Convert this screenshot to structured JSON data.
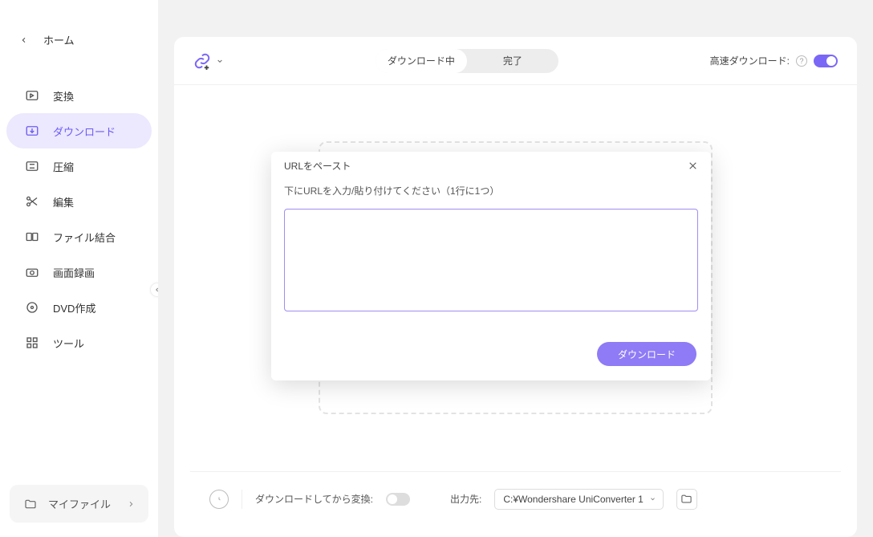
{
  "sidebar": {
    "home_label": "ホーム",
    "items": [
      {
        "label": "変換"
      },
      {
        "label": "ダウンロード"
      },
      {
        "label": "圧縮"
      },
      {
        "label": "編集"
      },
      {
        "label": "ファイル結合"
      },
      {
        "label": "画面録画"
      },
      {
        "label": "DVD作成"
      },
      {
        "label": "ツール"
      }
    ],
    "myfiles_label": "マイファイル"
  },
  "header_tabs": {
    "downloading": "ダウンロード中",
    "completed": "完了"
  },
  "hsd_label": "高速ダウンロード:",
  "footer": {
    "convert_after_label": "ダウンロードしてから変換:",
    "output_label": "出力先:",
    "output_path": "C:¥Wondershare UniConverter 1"
  },
  "modal": {
    "title": "URLをペースト",
    "subtitle": "下にURLを入力/貼り付けてください（1行に1つ）",
    "button": "ダウンロード"
  }
}
